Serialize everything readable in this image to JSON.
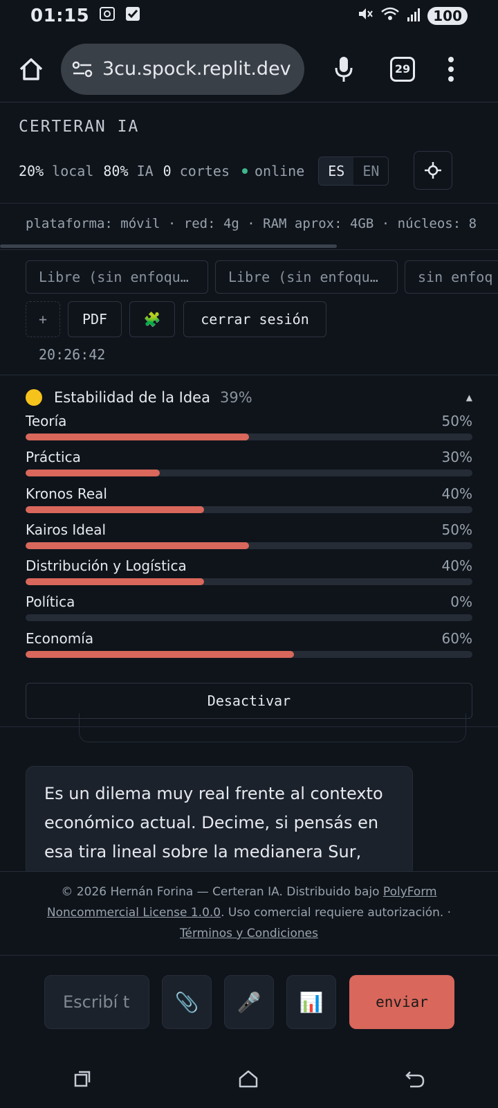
{
  "status_bar": {
    "time": "01:15",
    "battery": "100"
  },
  "browser": {
    "url": "3cu.spock.replit.dev",
    "tab_count": "29"
  },
  "header": {
    "title": "CERTERAN IA",
    "stat_local_value": "20%",
    "stat_local_label": "local",
    "stat_ia_value": "80%",
    "stat_ia_label": "IA",
    "stat_cuts_value": "0",
    "stat_cuts_label": "cortes",
    "status_label": "online",
    "lang_es": "ES",
    "lang_en": "EN"
  },
  "platform_info": "plataforma: móvil · red: 4g · RAM aprox: 4GB · núcleos: 8",
  "focus_chips": [
    "Libre (sin enfoqu…",
    "Libre (sin enfoqu…",
    "sin enfoq"
  ],
  "toolbar": {
    "add_label": "+",
    "pdf_label": "PDF",
    "puzzle_icon": "🧩",
    "logout_label": "cerrar sesión",
    "clock": "20:26:42"
  },
  "stability": {
    "title": "Estabilidad de la Idea",
    "percent": "39%",
    "accent": "#d9675b",
    "metrics": [
      {
        "label": "Teoría",
        "value": "50%",
        "level": 50
      },
      {
        "label": "Práctica",
        "value": "30%",
        "level": 30
      },
      {
        "label": "Kronos Real",
        "value": "40%",
        "level": 40
      },
      {
        "label": "Kairos Ideal",
        "value": "50%",
        "level": 50
      },
      {
        "label": "Distribución y Logística",
        "value": "40%",
        "level": 40
      },
      {
        "label": "Política",
        "value": "0%",
        "level": 0
      },
      {
        "label": "Economía",
        "value": "60%",
        "level": 60
      }
    ],
    "deactivate_label": "Desactivar"
  },
  "message": {
    "text": "Es un dilema muy real frente al contexto económico actual. Decime, si pensás en esa tira lineal sobre la medianera Sur,"
  },
  "footer": {
    "prefix": "© 2026 Hernán Forina — Certeran IA. Distribuido bajo ",
    "license_link": "PolyForm Noncommercial License 1.0.0",
    "suffix": ". Uso comercial requiere autorización. ·",
    "terms_link": "Términos y Condiciones"
  },
  "composer": {
    "placeholder": "Escribí t",
    "attach_icon": "📎",
    "mic_icon": "🎤",
    "chart_icon": "📊",
    "send_label": "enviar"
  }
}
